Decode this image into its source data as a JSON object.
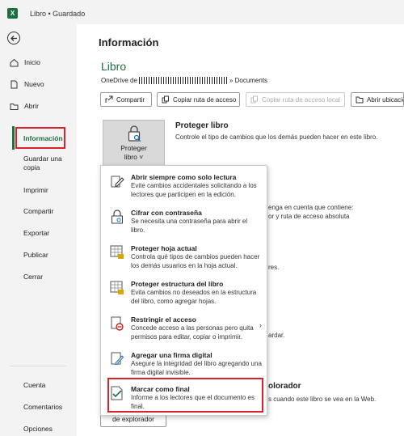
{
  "titlebar": {
    "app_icon": "X",
    "title": "Libro • Guardado"
  },
  "sidebar": {
    "back": "back-arrow-icon",
    "items": [
      {
        "label": "Inicio"
      },
      {
        "label": "Nuevo"
      },
      {
        "label": "Abrir"
      },
      {
        "label": "Información"
      },
      {
        "label": "Guardar una copia"
      },
      {
        "label": "Imprimir"
      },
      {
        "label": "Compartir"
      },
      {
        "label": "Exportar"
      },
      {
        "label": "Publicar"
      },
      {
        "label": "Cerrar"
      }
    ],
    "bottom": [
      {
        "label": "Cuenta"
      },
      {
        "label": "Comentarios"
      },
      {
        "label": "Opciones"
      }
    ]
  },
  "main": {
    "page_title": "Información",
    "section_title": "Libro",
    "onedrive_prefix": "OneDrive de",
    "onedrive_suffix": "» Documents",
    "buttons": [
      {
        "label": "Compartir"
      },
      {
        "label": "Copiar ruta de acceso"
      },
      {
        "label": "Copiar ruta de acceso local"
      },
      {
        "label": "Abrir ubicación"
      }
    ],
    "protect": {
      "tile_label_1": "Proteger",
      "tile_label_2": "libro ˅",
      "title": "Proteger libro",
      "description": "Controle el tipo de cambios que los demás pueden hacer en este libro."
    },
    "background_fragments": {
      "f1": "enga en cuenta que contiene:",
      "f2": "or y ruta de acceso absoluta",
      "f3": "res.",
      "f4": "ardar.",
      "f5": "olorador",
      "f6": "s cuando este libro se vea en la Web."
    },
    "browser_button": "de explorador"
  },
  "dropdown": {
    "items": [
      {
        "title": "Abrir siempre como solo lectura",
        "desc": "Evite cambios accidentales solicitando a los lectores que participen en la edición."
      },
      {
        "title": "Cifrar con contraseña",
        "desc": "Se necesita una contraseña para abrir el libro."
      },
      {
        "title": "Proteger hoja actual",
        "desc": "Controla qué tipos de cambios pueden hacer los demás usuarios en la hoja actual."
      },
      {
        "title": "Proteger estructura del libro",
        "desc": "Evita cambios no deseados en la estructura del libro, como agregar hojas."
      },
      {
        "title": "Restringir el acceso",
        "desc": "Concede acceso a las personas pero quita permisos para editar, copiar o imprimir."
      },
      {
        "title": "Agregar una firma digital",
        "desc": "Asegure la integridad del libro agregando una firma digital invisible."
      },
      {
        "title": "Marcar como final",
        "desc": "Informe a los lectores que el documento es final."
      }
    ]
  },
  "colors": {
    "accent": "#1d6f42",
    "highlight": "#d8232a"
  }
}
